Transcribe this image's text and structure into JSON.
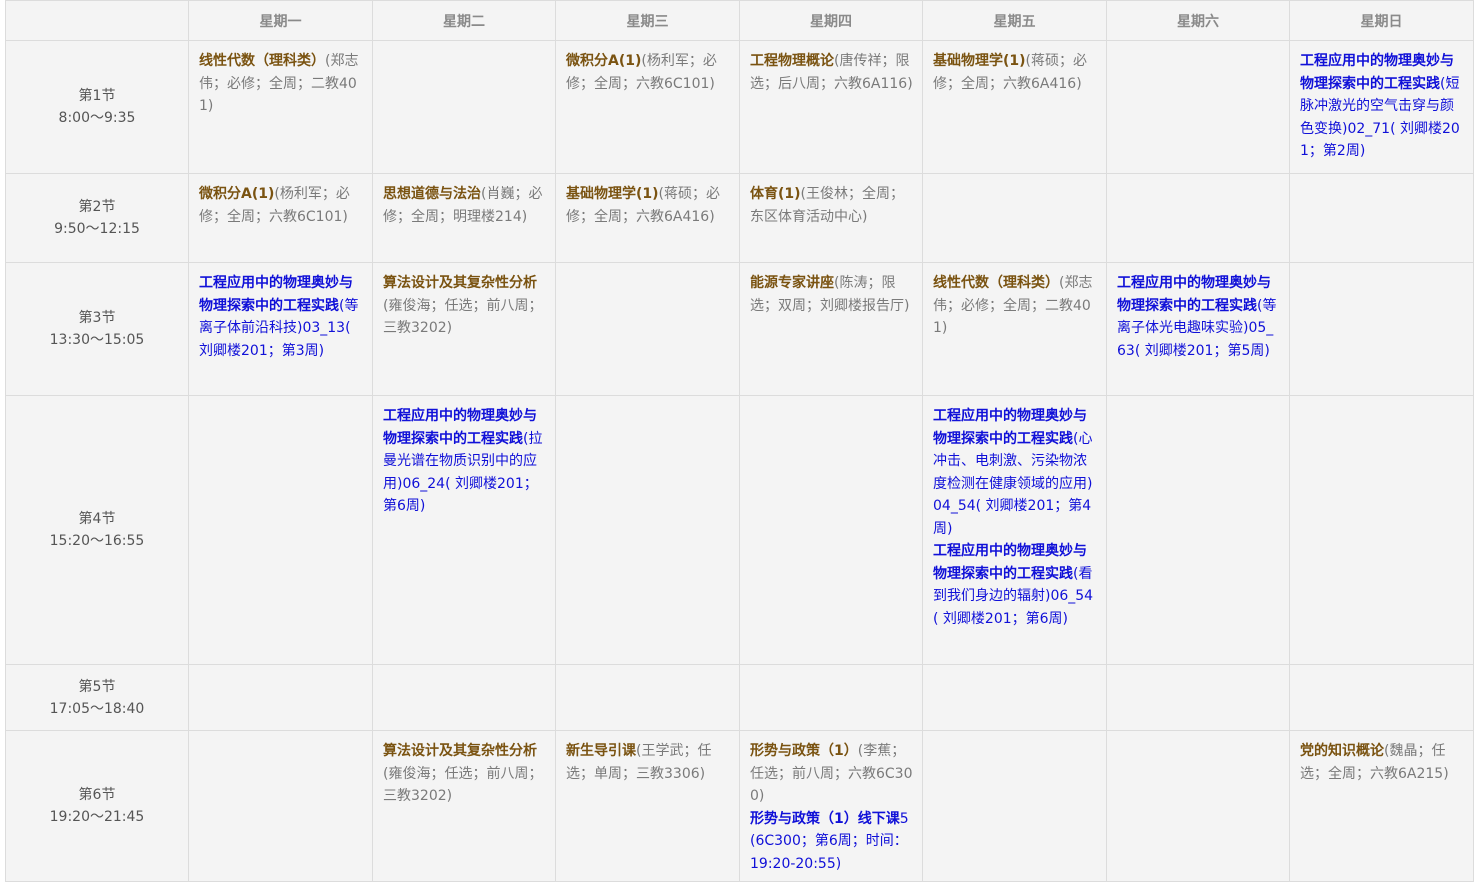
{
  "days": [
    "星期一",
    "星期二",
    "星期三",
    "星期四",
    "星期五",
    "星期六",
    "星期日"
  ],
  "periods": [
    {
      "name": "第1节",
      "time": "8:00～9:35"
    },
    {
      "name": "第2节",
      "time": "9:50～12:15"
    },
    {
      "name": "第3节",
      "time": "13:30～15:05"
    },
    {
      "name": "第4节",
      "time": "15:20～16:55"
    },
    {
      "name": "第5节",
      "time": "17:05～18:40"
    },
    {
      "name": "第6节",
      "time": "19:20～21:45"
    }
  ],
  "grid": [
    [
      [
        {
          "title": "线性代数（理科类）",
          "info": "(郑志伟；必修；全周；二教401)",
          "kind": "regular"
        }
      ],
      [],
      [
        {
          "title": "微积分A(1)",
          "info": "(杨利军；必修；全周；六教6C101)",
          "kind": "regular"
        }
      ],
      [
        {
          "title": "工程物理概论",
          "info": "(唐传祥；限选；后八周；六教6A116)",
          "kind": "regular"
        }
      ],
      [
        {
          "title": "基础物理学(1)",
          "info": "(蒋硕；必修；全周；六教6A416)",
          "kind": "regular"
        }
      ],
      [],
      [
        {
          "title": "工程应用中的物理奥妙与物理探索中的工程实践",
          "info": "(短脉冲激光的空气击穿与颜色变换)02_71( 刘卿楼201；第2周)",
          "kind": "special"
        }
      ]
    ],
    [
      [
        {
          "title": "微积分A(1)",
          "info": "(杨利军；必修；全周；六教6C101)",
          "kind": "regular"
        }
      ],
      [
        {
          "title": "思想道德与法治",
          "info": "(肖巍；必修；全周；明理楼214)",
          "kind": "regular"
        }
      ],
      [
        {
          "title": "基础物理学(1)",
          "info": "(蒋硕；必修；全周；六教6A416)",
          "kind": "regular"
        }
      ],
      [
        {
          "title": "体育(1)",
          "info": "(王俊林；全周；东区体育活动中心)",
          "kind": "regular"
        }
      ],
      [],
      [],
      []
    ],
    [
      [
        {
          "title": "工程应用中的物理奥妙与物理探索中的工程实践",
          "info": "(等离子体前沿科技)03_13( 刘卿楼201；第3周)",
          "kind": "special"
        }
      ],
      [
        {
          "title": "算法设计及其复杂性分析",
          "info": "(雍俊海；任选；前八周；三教3202)",
          "kind": "regular"
        }
      ],
      [],
      [
        {
          "title": "能源专家讲座",
          "info": "(陈涛；限选；双周；刘卿楼报告厅)",
          "kind": "regular"
        }
      ],
      [
        {
          "title": "线性代数（理科类）",
          "info": "(郑志伟；必修；全周；二教401)",
          "kind": "regular"
        }
      ],
      [
        {
          "title": "工程应用中的物理奥妙与物理探索中的工程实践",
          "info": "(等离子体光电趣味实验)05_63( 刘卿楼201；第5周)",
          "kind": "special"
        }
      ],
      []
    ],
    [
      [],
      [
        {
          "title": "工程应用中的物理奥妙与物理探索中的工程实践",
          "info": "(拉曼光谱在物质识别中的应用)06_24( 刘卿楼201；第6周)",
          "kind": "special"
        }
      ],
      [],
      [],
      [
        {
          "title": "工程应用中的物理奥妙与物理探索中的工程实践",
          "info": "(心冲击、电刺激、污染物浓度检测在健康领域的应用)04_54( 刘卿楼201；第4周)",
          "kind": "special"
        },
        {
          "title": "工程应用中的物理奥妙与物理探索中的工程实践",
          "info": "(看到我们身边的辐射)06_54( 刘卿楼201；第6周)",
          "kind": "special"
        }
      ],
      [],
      []
    ],
    [
      [],
      [],
      [],
      [],
      [],
      [],
      []
    ],
    [
      [],
      [
        {
          "title": "算法设计及其复杂性分析",
          "info": "(雍俊海；任选；前八周；三教3202)",
          "kind": "regular"
        }
      ],
      [
        {
          "title": "新生导引课",
          "info": "(王学武；任选；单周；三教3306)",
          "kind": "regular"
        }
      ],
      [
        {
          "title": "形势与政策（1）",
          "info": "(李蕉；任选；前八周；六教6C300)",
          "kind": "regular"
        },
        {
          "title": "形势与政策（1）线下课",
          "info": "5(6C300；第6周；时间：19:20-20:55)",
          "kind": "special"
        }
      ],
      [],
      [],
      [
        {
          "title": "党的知识概论",
          "info": "(魏晶；任选；全周；六教6A215)",
          "kind": "regular"
        }
      ]
    ]
  ],
  "colors": {
    "course_title": "#7a5311",
    "special_course": "#1010d8",
    "info_text": "#7a7a7a",
    "cell_bg": "#f4f4f4",
    "border": "#dcdcdc"
  }
}
